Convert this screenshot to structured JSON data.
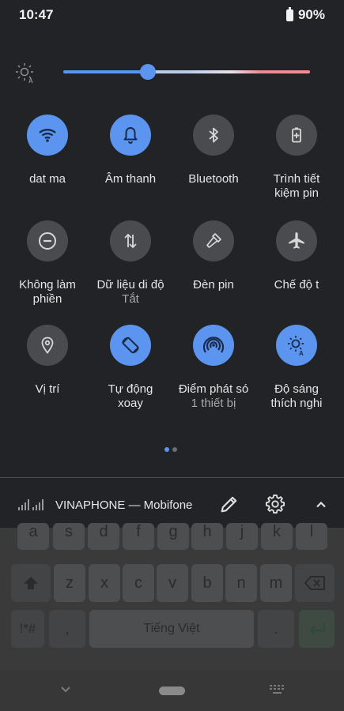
{
  "status_bar": {
    "time": "10:47",
    "battery": "90%"
  },
  "tiles": [
    {
      "label": "dat ma",
      "sub": "",
      "state": "on",
      "icon": "wifi-icon"
    },
    {
      "label": "Âm thanh",
      "sub": "",
      "state": "on",
      "icon": "bell-icon"
    },
    {
      "label": "Bluetooth",
      "sub": "",
      "state": "off",
      "icon": "bluetooth-icon"
    },
    {
      "label": "Trình tiết",
      "label2": "kiệm pin",
      "sub": "",
      "state": "off",
      "icon": "battery-saver-icon"
    },
    {
      "label": "Không làm",
      "label2": "phiền",
      "state": "off",
      "icon": "do-not-disturb-icon"
    },
    {
      "label": "Dữ liệu di độ",
      "sub": "Tắt",
      "state": "off",
      "icon": "mobile-data-icon"
    },
    {
      "label": "Đèn pin",
      "sub": "",
      "state": "off",
      "icon": "flashlight-icon"
    },
    {
      "label": "Chế độ t",
      "sub": "",
      "state": "off",
      "icon": "airplane-icon"
    },
    {
      "label": "Vị trí",
      "sub": "",
      "state": "off",
      "icon": "location-icon"
    },
    {
      "label": "Tự động",
      "label2": "xoay",
      "state": "on",
      "icon": "auto-rotate-icon"
    },
    {
      "label": "Điểm phát só",
      "sub": "1 thiết bị",
      "state": "on",
      "icon": "hotspot-icon"
    },
    {
      "label": "Độ sáng",
      "label2": "thích nghi",
      "state": "on",
      "icon": "adaptive-brightness-icon"
    }
  ],
  "footer": {
    "carrier": "VINAPHONE — Mobifone"
  },
  "keyboard": {
    "row1": [
      "a",
      "s",
      "d",
      "f",
      "g",
      "h",
      "j",
      "k",
      "l"
    ],
    "row2": [
      "z",
      "x",
      "c",
      "v",
      "b",
      "n",
      "m"
    ],
    "row3": {
      "symbols": "!*#",
      "comma": ",",
      "space": "Tiếng Việt",
      "period": "."
    }
  },
  "colors": {
    "accent": "#5b95ef",
    "background": "#222326",
    "tile_off": "#4a4b4e"
  }
}
